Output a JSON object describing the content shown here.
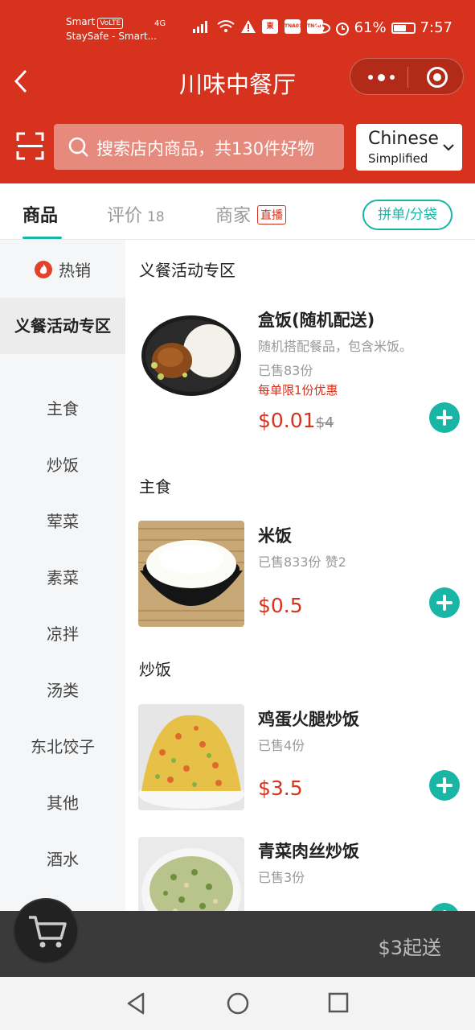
{
  "status_bar": {
    "carrier_line1": "Smart",
    "volte": "VoLTE",
    "carrier_line2": "StaySafe - Smart...",
    "network": "4G",
    "app_badges": [
      "東",
      "TNA01",
      "TN401"
    ],
    "battery": "61%",
    "battery_level": 0.61,
    "time": "7:57"
  },
  "header": {
    "title": "川味中餐厅"
  },
  "search": {
    "placeholder": "搜索店内商品，共130件好物"
  },
  "language": {
    "primary": "Chinese",
    "secondary": "Simplified"
  },
  "tabs": [
    {
      "label": "商品",
      "active": true
    },
    {
      "label": "评价",
      "count": "18"
    },
    {
      "label": "商家",
      "badge": "直播"
    }
  ],
  "group_button": "拼单/分袋",
  "sidebar": {
    "items": [
      {
        "label": "热销",
        "icon": "flame-icon"
      },
      {
        "label": "义餐活动专区",
        "active": true
      },
      {
        "label": "主食"
      },
      {
        "label": "炒饭"
      },
      {
        "label": "荤菜"
      },
      {
        "label": "素菜"
      },
      {
        "label": "凉拌"
      },
      {
        "label": "汤类"
      },
      {
        "label": "东北饺子"
      },
      {
        "label": "其他"
      },
      {
        "label": "酒水"
      }
    ]
  },
  "sections": [
    {
      "title": "义餐活动专区",
      "products": [
        {
          "name": "盒饭(随机配送)",
          "desc": "随机搭配餐品，包含米饭。",
          "sold": "已售83份",
          "promo": "每单限1份优惠",
          "price": "$0.01",
          "orig_price": "$4"
        }
      ]
    },
    {
      "title": "主食",
      "products": [
        {
          "name": "米饭",
          "sold": "已售833份  赞2",
          "price": "$0.5"
        }
      ]
    },
    {
      "title": "炒饭",
      "products": [
        {
          "name": "鸡蛋火腿炒饭",
          "sold": "已售4份",
          "price": "$3.5"
        },
        {
          "name": "青菜肉丝炒饭",
          "sold": "已售3份"
        }
      ]
    }
  ],
  "cart": {
    "min_order": "$3起送"
  },
  "colors": {
    "brand_red": "#d6321d",
    "accent_teal": "#19b5a5"
  }
}
